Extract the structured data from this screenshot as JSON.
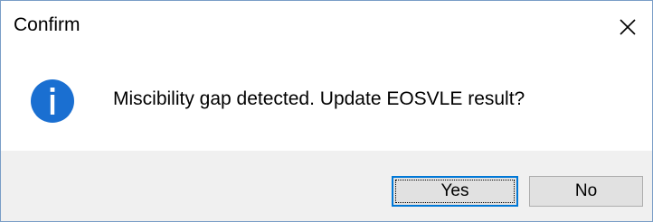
{
  "dialog": {
    "title": "Confirm",
    "message": "Miscibility gap detected. Update EOSVLE result?",
    "icon": "information-icon",
    "buttons": {
      "yes_label": "Yes",
      "no_label": "No",
      "default": "Yes"
    }
  },
  "colors": {
    "icon_blue": "#1a6fd1",
    "button_focus_border": "#0078d7",
    "footer_background": "#f0f0f0",
    "button_background": "#e1e1e1"
  }
}
